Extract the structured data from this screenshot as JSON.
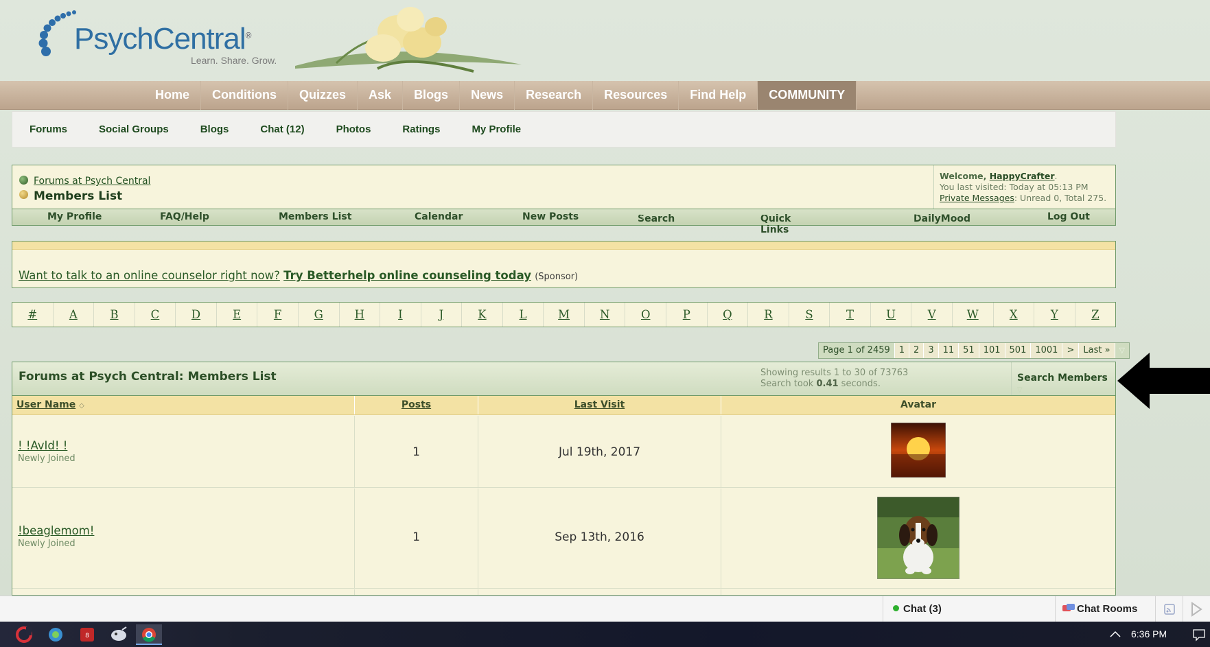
{
  "brand": {
    "logo_text": "PsychCentral",
    "logo_mark": "®",
    "tagline": "Learn. Share. Grow."
  },
  "main_nav": [
    "Home",
    "Conditions",
    "Quizzes",
    "Ask",
    "Blogs",
    "News",
    "Research",
    "Resources",
    "Find Help",
    "COMMUNITY"
  ],
  "sub_nav": [
    "Forums",
    "Social Groups",
    "Blogs",
    "Chat (12)",
    "Photos",
    "Ratings",
    "My Profile"
  ],
  "breadcrumb": {
    "parent": "Forums at Psych Central",
    "current": "Members List"
  },
  "welcome": {
    "greeting": "Welcome, ",
    "username": "HappyCrafter",
    "period": ".",
    "last_visited": "You last visited: Today at 05:13 PM",
    "pm_link": "Private Messages",
    "pm_stats": ": Unread 0, Total 275."
  },
  "toolbar": [
    {
      "label": "My Profile",
      "menu": false
    },
    {
      "label": "FAQ/Help",
      "menu": false
    },
    {
      "label": "Members List",
      "menu": false
    },
    {
      "label": "Calendar",
      "menu": false
    },
    {
      "label": "New Posts",
      "menu": false
    },
    {
      "label": "Search",
      "menu": true
    },
    {
      "label": "Quick Links",
      "menu": true
    },
    {
      "label": "DailyMood",
      "menu": true
    },
    {
      "label": "Log Out",
      "menu": false
    }
  ],
  "sponsor": {
    "text": "Want to talk to an online counselor right now?",
    "link": "Try Betterhelp online counseling today",
    "tag": "(Sponsor)"
  },
  "letters": [
    "#",
    "A",
    "B",
    "C",
    "D",
    "E",
    "F",
    "G",
    "H",
    "I",
    "J",
    "K",
    "L",
    "M",
    "N",
    "O",
    "P",
    "Q",
    "R",
    "S",
    "T",
    "U",
    "V",
    "W",
    "X",
    "Y",
    "Z"
  ],
  "pagination": {
    "label": "Page 1 of 2459",
    "pages": [
      "1",
      "2",
      "3",
      "11",
      "51",
      "101",
      "501",
      "1001",
      ">",
      "Last »"
    ]
  },
  "members": {
    "title": "Forums at Psych Central: Members List",
    "showing": "Showing results 1 to 30 of 73763",
    "search_took_prefix": "Search took ",
    "search_time": "0.41",
    "search_took_suffix": " seconds.",
    "search_button": "Search Members",
    "columns": [
      "User Name",
      "Posts",
      "Last Visit",
      "Avatar"
    ],
    "rows": [
      {
        "name": "! !AvId! !",
        "rank": "Newly Joined",
        "posts": "1",
        "last_visit": "Jul 19th, 2017",
        "avatar": "sunset-avatar"
      },
      {
        "name": "!beaglemom!",
        "rank": "Newly Joined",
        "posts": "1",
        "last_visit": "Sep 13th, 2016",
        "avatar": "beagle-puppy-avatar"
      }
    ]
  },
  "chat_bar": {
    "chat": "Chat (3)",
    "rooms": "Chat Rooms"
  },
  "taskbar": {
    "time": "6:36 PM",
    "apps": [
      "ccleaner-icon",
      "network-app-icon",
      "game-app-icon",
      "app-icon",
      "chrome-icon"
    ]
  },
  "colors": {
    "page_bg": "#d9e2d4",
    "panel_bg": "#f7f4dc",
    "border_green": "#6f9a6a",
    "link_green": "#2a5a26",
    "nav_tan": "#bca48d",
    "column_header": "#f3e2a4"
  }
}
